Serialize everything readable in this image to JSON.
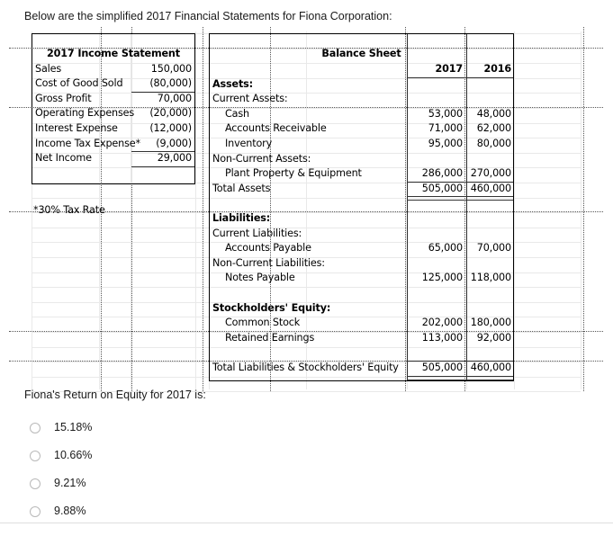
{
  "intro": "Below are the simplified 2017 Financial Statements for Fiona Corporation:",
  "income_statement": {
    "title": "2017 Income Statement",
    "rows": [
      {
        "label": "Sales",
        "value": "150,000"
      },
      {
        "label": "Cost of Good Sold",
        "value": "(80,000)"
      },
      {
        "label": "Gross Profit",
        "value": "70,000"
      },
      {
        "label": "Operating Expenses",
        "value": "(20,000)"
      },
      {
        "label": "Interest Expense",
        "value": "(12,000)"
      },
      {
        "label": "Income Tax Expense*",
        "value": "(9,000)"
      },
      {
        "label": "Net Income",
        "value": "29,000"
      }
    ],
    "footnote": "*30% Tax Rate"
  },
  "balance_sheet": {
    "title": "Balance Sheet",
    "columns": [
      "2017",
      "2016"
    ],
    "rows": [
      {
        "label": "Assets:",
        "v2017": "",
        "v2016": "",
        "bold": true,
        "indent": 0
      },
      {
        "label": "Current Assets:",
        "v2017": "",
        "v2016": "",
        "bold": false,
        "indent": 0
      },
      {
        "label": "Cash",
        "v2017": "53,000",
        "v2016": "48,000",
        "bold": false,
        "indent": 1
      },
      {
        "label": "Accounts Receivable",
        "v2017": "71,000",
        "v2016": "62,000",
        "bold": false,
        "indent": 1
      },
      {
        "label": "Inventory",
        "v2017": "95,000",
        "v2016": "80,000",
        "bold": false,
        "indent": 1
      },
      {
        "label": "Non-Current Assets:",
        "v2017": "",
        "v2016": "",
        "bold": false,
        "indent": 0
      },
      {
        "label": "Plant Property & Equipment",
        "v2017": "286,000",
        "v2016": "270,000",
        "bold": false,
        "indent": 1
      },
      {
        "label": "Total Assets",
        "v2017": "505,000",
        "v2016": "460,000",
        "bold": false,
        "indent": 0
      },
      {
        "label": "",
        "v2017": "",
        "v2016": "",
        "bold": false,
        "indent": 0
      },
      {
        "label": "Liabilities:",
        "v2017": "",
        "v2016": "",
        "bold": true,
        "indent": 0
      },
      {
        "label": "Current Liabilities:",
        "v2017": "",
        "v2016": "",
        "bold": false,
        "indent": 0
      },
      {
        "label": "Accounts Payable",
        "v2017": "65,000",
        "v2016": "70,000",
        "bold": false,
        "indent": 1
      },
      {
        "label": "Non-Current Liabilities:",
        "v2017": "",
        "v2016": "",
        "bold": false,
        "indent": 0
      },
      {
        "label": "Notes Payable",
        "v2017": "125,000",
        "v2016": "118,000",
        "bold": false,
        "indent": 1
      },
      {
        "label": "",
        "v2017": "",
        "v2016": "",
        "bold": false,
        "indent": 0
      },
      {
        "label": "Stockholders' Equity:",
        "v2017": "",
        "v2016": "",
        "bold": true,
        "indent": 0
      },
      {
        "label": "Common Stock",
        "v2017": "202,000",
        "v2016": "180,000",
        "bold": false,
        "indent": 1
      },
      {
        "label": "Retained Earnings",
        "v2017": "113,000",
        "v2016": "92,000",
        "bold": false,
        "indent": 1
      },
      {
        "label": "",
        "v2017": "",
        "v2016": "",
        "bold": false,
        "indent": 0
      },
      {
        "label": "Total Liabilities & Stockholders' Equity",
        "v2017": "505,000",
        "v2016": "460,000",
        "bold": false,
        "indent": 0
      }
    ]
  },
  "question": {
    "text": "Fiona's Return on Equity for 2017 is:",
    "options": [
      {
        "label": "15.18%",
        "selected": false
      },
      {
        "label": "10.66%",
        "selected": false
      },
      {
        "label": "9.21%",
        "selected": false
      },
      {
        "label": "9.88%",
        "selected": false
      }
    ]
  }
}
